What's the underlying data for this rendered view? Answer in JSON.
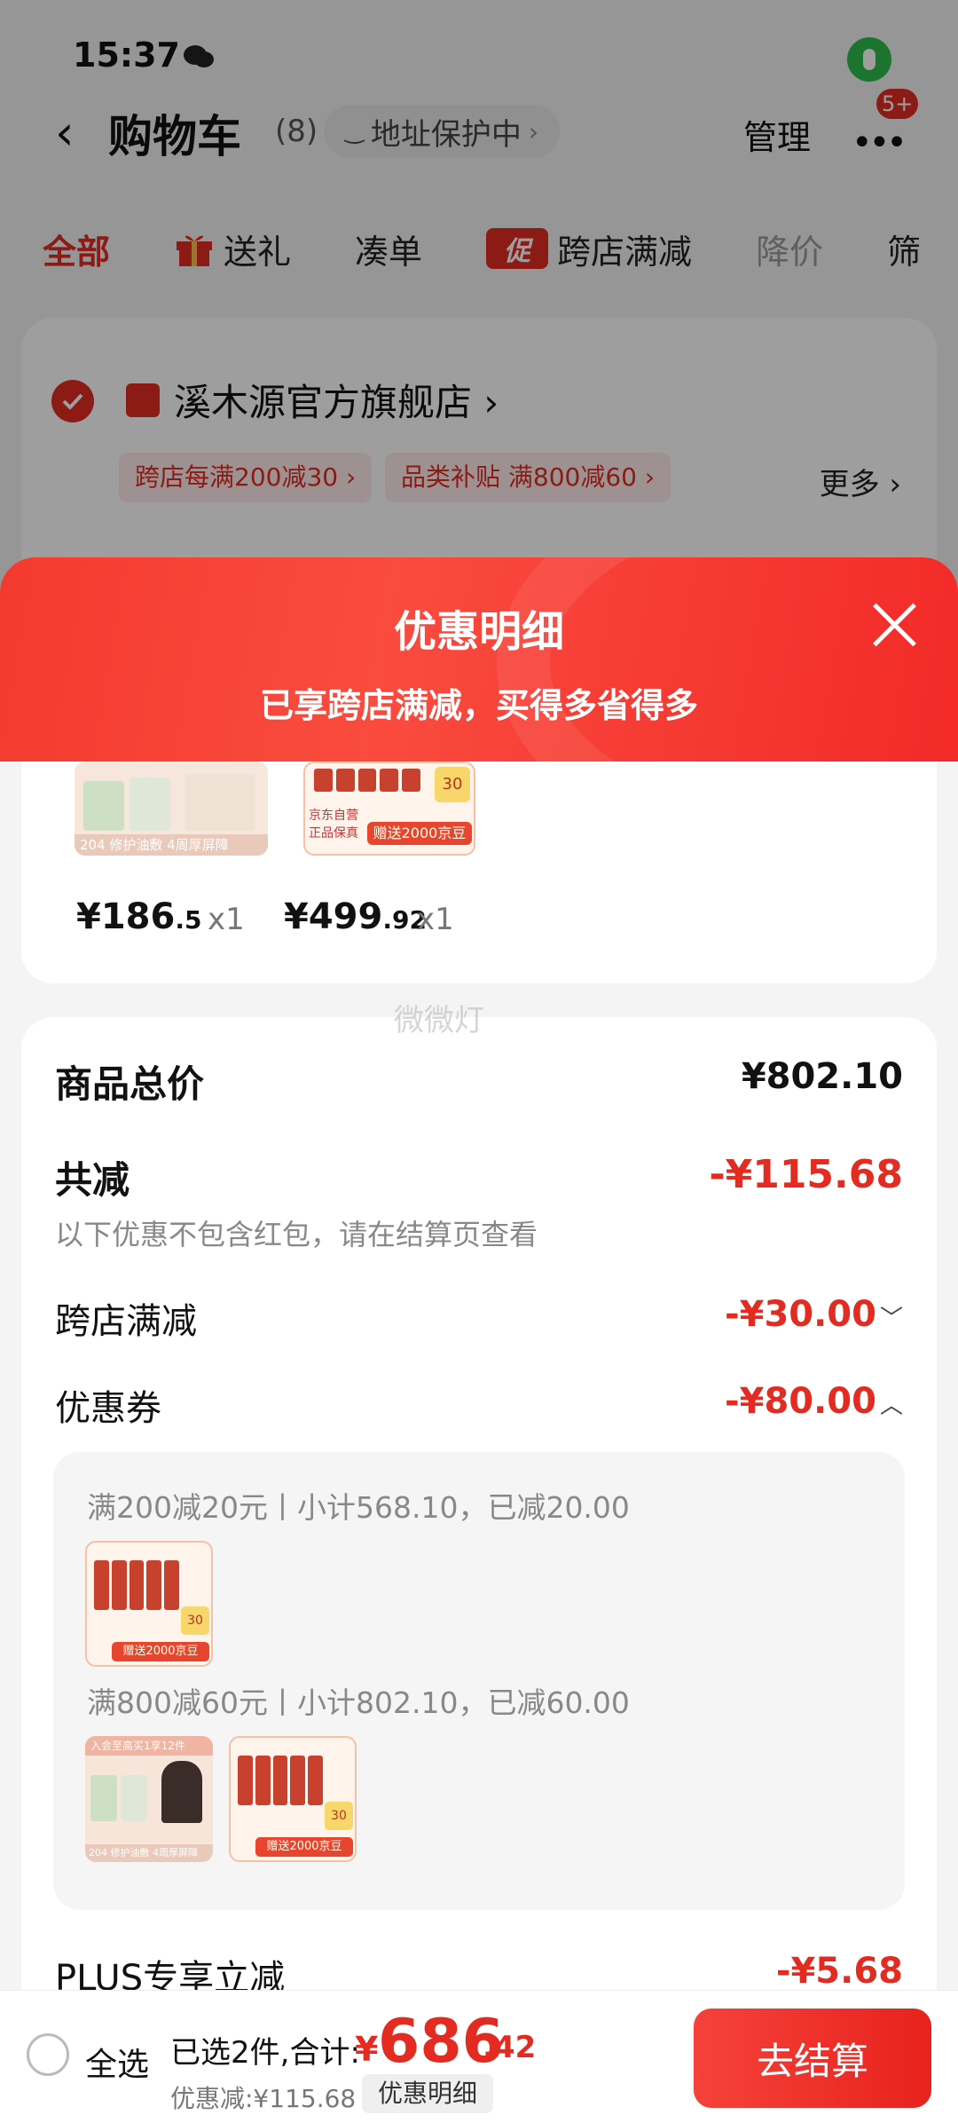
{
  "status": {
    "time": "15:37"
  },
  "nav": {
    "back": "‹",
    "title": "购物车",
    "count": "(8)",
    "address_protect": "地址保护中",
    "manage": "管理",
    "more": "•••",
    "badge": "5+"
  },
  "tabs": [
    {
      "label": "全部"
    },
    {
      "label": "送礼"
    },
    {
      "label": "凑单"
    },
    {
      "label": "跨店满减",
      "icon_text": "促"
    },
    {
      "label": "降价"
    },
    {
      "label": "筛"
    }
  ],
  "shop": {
    "name": "溪木源官方旗舰店",
    "promos": [
      "跨店每满200减30 ›",
      "品类补贴 满800减60 ›"
    ],
    "more": "更多 ›"
  },
  "sheet": {
    "title": "优惠明细",
    "subtitle": "已享跨店满减，买得多省得多"
  },
  "items": [
    {
      "price_main": "¥186",
      "price_dec": ".5",
      "qty": "x1"
    },
    {
      "price_main": "¥499",
      "price_dec": ".92",
      "qty": "x1"
    }
  ],
  "thumb_texts": {
    "p1_banner": "入会至高买1享12件",
    "p1_bottom": "204  修护油敷 4周厚屏障",
    "p2_banner": "京东自营 正品保真",
    "p2_bottom": "赠送2000京豆",
    "p2_badge": "30"
  },
  "detail": {
    "goods_total_label": "商品总价",
    "goods_total_value": "¥802.10",
    "total_discount_label": "共减",
    "total_discount_value": "-¥115.68",
    "note": "以下优惠不包含红包，请在结算页查看",
    "cross_store_label": "跨店满减",
    "cross_store_value": "-¥30.00",
    "coupon_label": "优惠券",
    "coupon_value": "-¥80.00",
    "coupon_lines": [
      "满200减20元丨小计568.10，已减20.00",
      "满800减60元丨小计802.10，已减60.00"
    ],
    "plus_label": "PLUS专享立减",
    "plus_value": "-¥5.68"
  },
  "watermark": "微微灯",
  "bottom": {
    "select_all": "全选",
    "selected": "已选2件,合计:",
    "currency": "¥",
    "total_main": "686",
    "total_dec": ".42",
    "discount": "优惠减:¥115.68",
    "detail_button": "优惠明细",
    "checkout": "去结算"
  },
  "colors": {
    "accent": "#e32b22",
    "mic_green": "#2ebd4d"
  }
}
